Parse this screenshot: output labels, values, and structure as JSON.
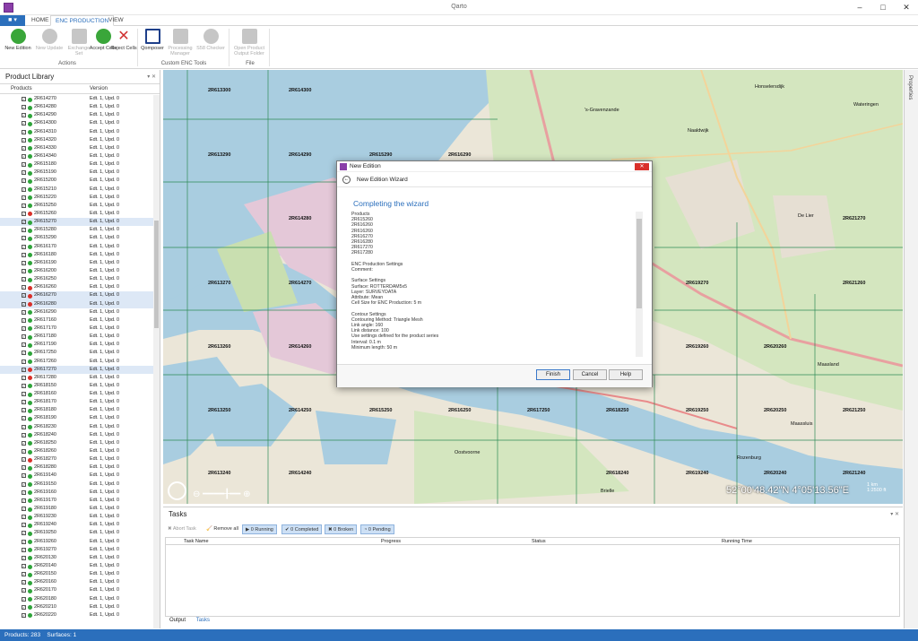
{
  "window": {
    "title": "Qarto"
  },
  "ribbon": {
    "file_label": "■ ▾",
    "tabs": [
      "HOME",
      "ENC PRODUCTION",
      "VIEW"
    ],
    "buttons": [
      {
        "label": "New Edition",
        "icon": "add-circle-icon",
        "color": "#3aa63a",
        "enabled": true
      },
      {
        "label": "New Update",
        "icon": "add-circle-icon",
        "color": "#bbbbbb",
        "enabled": false
      },
      {
        "label": "Exchange Set",
        "icon": "briefcase-icon",
        "color": "#bbbbbb",
        "enabled": false
      },
      {
        "label": "Accept Cells",
        "icon": "check-circle-icon",
        "color": "#3aa63a",
        "enabled": true
      },
      {
        "label": "Reject Cells",
        "icon": "x-icon",
        "color": "#d03030",
        "enabled": true
      },
      {
        "label": "Qomposer",
        "icon": "pen-box-icon",
        "color": "#1e3f8a",
        "enabled": true
      },
      {
        "label": "Processing Manager",
        "icon": "server-icon",
        "color": "#bbbbbb",
        "enabled": false
      },
      {
        "label": "S58 Checker",
        "icon": "robot-icon",
        "color": "#bbbbbb",
        "enabled": false
      },
      {
        "label": "Open Product Output Folder",
        "icon": "folder-icon",
        "color": "#bbbbbb",
        "enabled": false
      }
    ],
    "groups": [
      "Actions",
      "Custom ENC Tools",
      "File"
    ]
  },
  "product_library": {
    "title": "Product Library",
    "col_products": "Products",
    "col_version": "Version",
    "rows": [
      {
        "name": "2R614270",
        "ver": "Edt. 1, Upd. 0",
        "st": "g"
      },
      {
        "name": "2R614280",
        "ver": "Edt. 1, Upd. 0",
        "st": "g"
      },
      {
        "name": "2R614290",
        "ver": "Edt. 1, Upd. 0",
        "st": "g"
      },
      {
        "name": "2R614300",
        "ver": "Edt. 1, Upd. 0",
        "st": "g"
      },
      {
        "name": "2R614310",
        "ver": "Edt. 1, Upd. 0",
        "st": "g"
      },
      {
        "name": "2R614320",
        "ver": "Edt. 1, Upd. 0",
        "st": "g"
      },
      {
        "name": "2R614330",
        "ver": "Edt. 1, Upd. 0",
        "st": "g"
      },
      {
        "name": "2R614340",
        "ver": "Edt. 1, Upd. 0",
        "st": "g"
      },
      {
        "name": "2R615180",
        "ver": "Edt. 1, Upd. 0",
        "st": "g"
      },
      {
        "name": "2R615190",
        "ver": "Edt. 1, Upd. 0",
        "st": "g"
      },
      {
        "name": "2R615200",
        "ver": "Edt. 1, Upd. 0",
        "st": "g"
      },
      {
        "name": "2R615210",
        "ver": "Edt. 1, Upd. 0",
        "st": "g"
      },
      {
        "name": "2R615220",
        "ver": "Edt. 1, Upd. 0",
        "st": "g"
      },
      {
        "name": "2R615250",
        "ver": "Edt. 1, Upd. 0",
        "st": "g"
      },
      {
        "name": "2R615260",
        "ver": "Edt. 1, Upd. 0",
        "st": "r"
      },
      {
        "name": "2R615270",
        "ver": "Edt. 1, Upd. 0",
        "st": "g",
        "sel": true
      },
      {
        "name": "2R615280",
        "ver": "Edt. 1, Upd. 0",
        "st": "g"
      },
      {
        "name": "2R615290",
        "ver": "Edt. 1, Upd. 0",
        "st": "g"
      },
      {
        "name": "2R616170",
        "ver": "Edt. 1, Upd. 0",
        "st": "g"
      },
      {
        "name": "2R616180",
        "ver": "Edt. 1, Upd. 0",
        "st": "g"
      },
      {
        "name": "2R616190",
        "ver": "Edt. 1, Upd. 0",
        "st": "g"
      },
      {
        "name": "2R616200",
        "ver": "Edt. 1, Upd. 0",
        "st": "g"
      },
      {
        "name": "2R616250",
        "ver": "Edt. 1, Upd. 0",
        "st": "g"
      },
      {
        "name": "2R616260",
        "ver": "Edt. 1, Upd. 0",
        "st": "r"
      },
      {
        "name": "2R616270",
        "ver": "Edt. 1, Upd. 0",
        "st": "r",
        "sel": true
      },
      {
        "name": "2R616280",
        "ver": "Edt. 1, Upd. 0",
        "st": "r",
        "sel": true
      },
      {
        "name": "2R616290",
        "ver": "Edt. 1, Upd. 0",
        "st": "g"
      },
      {
        "name": "2R617160",
        "ver": "Edt. 1, Upd. 0",
        "st": "g"
      },
      {
        "name": "2R617170",
        "ver": "Edt. 1, Upd. 0",
        "st": "g"
      },
      {
        "name": "2R617180",
        "ver": "Edt. 1, Upd. 0",
        "st": "g"
      },
      {
        "name": "2R617190",
        "ver": "Edt. 1, Upd. 0",
        "st": "g"
      },
      {
        "name": "2R617250",
        "ver": "Edt. 1, Upd. 0",
        "st": "g"
      },
      {
        "name": "2R617260",
        "ver": "Edt. 1, Upd. 0",
        "st": "g"
      },
      {
        "name": "2R617270",
        "ver": "Edt. 1, Upd. 0",
        "st": "r",
        "sel": true
      },
      {
        "name": "2R617280",
        "ver": "Edt. 1, Upd. 0",
        "st": "r"
      },
      {
        "name": "2R618150",
        "ver": "Edt. 1, Upd. 0",
        "st": "g"
      },
      {
        "name": "2R618160",
        "ver": "Edt. 1, Upd. 0",
        "st": "g"
      },
      {
        "name": "2R618170",
        "ver": "Edt. 1, Upd. 0",
        "st": "g"
      },
      {
        "name": "2R618180",
        "ver": "Edt. 1, Upd. 0",
        "st": "g"
      },
      {
        "name": "2R618190",
        "ver": "Edt. 1, Upd. 0",
        "st": "g"
      },
      {
        "name": "2R618230",
        "ver": "Edt. 1, Upd. 0",
        "st": "g"
      },
      {
        "name": "2R618240",
        "ver": "Edt. 1, Upd. 0",
        "st": "g"
      },
      {
        "name": "2R618250",
        "ver": "Edt. 1, Upd. 0",
        "st": "g"
      },
      {
        "name": "2R618260",
        "ver": "Edt. 1, Upd. 0",
        "st": "g"
      },
      {
        "name": "2R618270",
        "ver": "Edt. 1, Upd. 0",
        "st": "r"
      },
      {
        "name": "2R618280",
        "ver": "Edt. 1, Upd. 0",
        "st": "g"
      },
      {
        "name": "2R619140",
        "ver": "Edt. 1, Upd. 0",
        "st": "g"
      },
      {
        "name": "2R619150",
        "ver": "Edt. 1, Upd. 0",
        "st": "g"
      },
      {
        "name": "2R619160",
        "ver": "Edt. 1, Upd. 0",
        "st": "g"
      },
      {
        "name": "2R619170",
        "ver": "Edt. 1, Upd. 0",
        "st": "g"
      },
      {
        "name": "2R619180",
        "ver": "Edt. 1, Upd. 0",
        "st": "g"
      },
      {
        "name": "2R619230",
        "ver": "Edt. 1, Upd. 0",
        "st": "g"
      },
      {
        "name": "2R619240",
        "ver": "Edt. 1, Upd. 0",
        "st": "g"
      },
      {
        "name": "2R619250",
        "ver": "Edt. 1, Upd. 0",
        "st": "g"
      },
      {
        "name": "2R619260",
        "ver": "Edt. 1, Upd. 0",
        "st": "g"
      },
      {
        "name": "2R619270",
        "ver": "Edt. 1, Upd. 0",
        "st": "g"
      },
      {
        "name": "2R620130",
        "ver": "Edt. 1, Upd. 0",
        "st": "g"
      },
      {
        "name": "2R620140",
        "ver": "Edt. 1, Upd. 0",
        "st": "g"
      },
      {
        "name": "2R620150",
        "ver": "Edt. 1, Upd. 0",
        "st": "g"
      },
      {
        "name": "2R620160",
        "ver": "Edt. 1, Upd. 0",
        "st": "g"
      },
      {
        "name": "2R620170",
        "ver": "Edt. 1, Upd. 0",
        "st": "g"
      },
      {
        "name": "2R620180",
        "ver": "Edt. 1, Upd. 0",
        "st": "g"
      },
      {
        "name": "2R620210",
        "ver": "Edt. 1, Upd. 0",
        "st": "g"
      },
      {
        "name": "2R620220",
        "ver": "Edt. 1, Upd. 0",
        "st": "g"
      }
    ]
  },
  "map": {
    "cell_labels": [
      {
        "text": "2R613300"
      },
      {
        "text": "2R614300"
      },
      {
        "text": "2R613290"
      },
      {
        "text": "2R614290"
      },
      {
        "text": "2R615290"
      },
      {
        "text": "2R616290"
      },
      {
        "text": "2R614280"
      },
      {
        "text": "2R613270"
      },
      {
        "text": "2R614270"
      },
      {
        "text": "2R619270"
      },
      {
        "text": "2R613260"
      },
      {
        "text": "2R614260"
      },
      {
        "text": "2R619260"
      },
      {
        "text": "2R620260"
      },
      {
        "text": "2R613250"
      },
      {
        "text": "2R614250"
      },
      {
        "text": "2R615250"
      },
      {
        "text": "2R616250"
      },
      {
        "text": "2R617250"
      },
      {
        "text": "2R618250"
      },
      {
        "text": "2R619250"
      },
      {
        "text": "2R620250"
      },
      {
        "text": "2R621250"
      },
      {
        "text": "2R613240"
      },
      {
        "text": "2R614240"
      },
      {
        "text": "2R618240"
      },
      {
        "text": "2R619240"
      },
      {
        "text": "2R620240"
      },
      {
        "text": "2R621240"
      },
      {
        "text": "2R621270"
      },
      {
        "text": "2R621260"
      }
    ],
    "place_labels": [
      "'s-Gravenzande",
      "Naaldwijk",
      "De Lier",
      "Maassluis",
      "Maasland",
      "Oostvoorne",
      "Brielle",
      "Rozenburg",
      "Honselersdijk",
      "Wateringen"
    ],
    "coordinates": "52°00'48.42\"N  4°05'13.56\"E",
    "scale_km": "1 km",
    "scale_ratio": "1:2500 ft"
  },
  "properties_tab": "Properties",
  "tasks": {
    "title": "Tasks",
    "abort": "Abort Task",
    "remove_all": "Remove all",
    "running": "0 Running",
    "completed": "0 Completed",
    "broken": "0 Broken",
    "pending": "0 Pending",
    "columns": [
      "Task Name",
      "Progress",
      "Status",
      "Running Time"
    ],
    "bottom_tabs": [
      "Output",
      "Tasks"
    ]
  },
  "status": {
    "products": "Products: 283",
    "surfaces": "Surfaces: 1"
  },
  "dialog": {
    "title": "New Edition",
    "close": "✕",
    "nav_title": "New Edition Wizard",
    "heading": "Completing the wizard",
    "summary": [
      "Products",
      "2R615260",
      "2R616260",
      "2R616260",
      "2R616270",
      "2R616280",
      "2R617270",
      "2R617280",
      "",
      "ENC Production Settings",
      "Comment:",
      "",
      "Surface Settings",
      "Surface: ROTTERDAM5x5",
      "Layer: SURVEYDATA",
      "Attribute: Mean",
      "Cell Size for ENC Production: 5 m",
      "",
      "Contour Settings",
      "Contouring Method: Triangle Mesh",
      "Link angle: 160",
      "Link distance: 100",
      "Use settings defined for the product series",
      "Interval: 0.1 m",
      "Minimum length: 50 m"
    ],
    "buttons": {
      "finish": "Finish",
      "cancel": "Cancel",
      "help": "Help"
    }
  },
  "colors": {
    "accent": "#2b6fbc",
    "water": "#a9cde0",
    "land": "#ebe6d8",
    "green": "#c9dfb0",
    "grid": "#2e8b57",
    "error": "#d9302a",
    "ok": "#2ea43a"
  }
}
